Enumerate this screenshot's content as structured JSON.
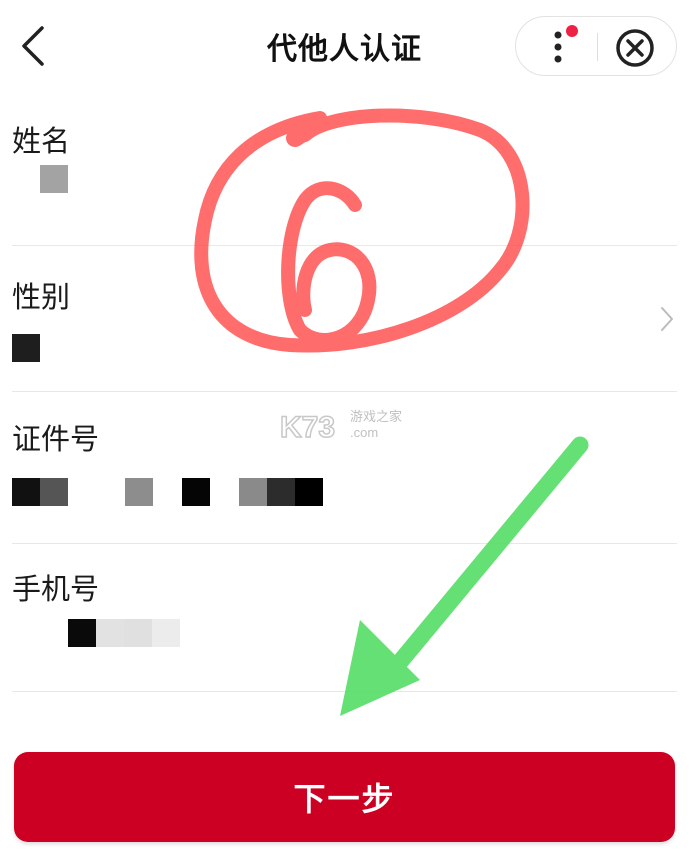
{
  "header": {
    "title": "代他人认证",
    "back_icon": "chevron-left-icon",
    "more_icon": "more-vertical-icon",
    "close_icon": "close-circle-icon",
    "notification_dot_color": "#ee2244"
  },
  "form": {
    "fields": [
      {
        "label": "姓名"
      },
      {
        "label": "性别"
      },
      {
        "label": "证件号"
      },
      {
        "label": "手机号"
      }
    ]
  },
  "watermark": {
    "brand": "K73",
    "cn": "游戏之家",
    "domain": ".com"
  },
  "footer": {
    "next_label": "下一步",
    "button_color": "#cc0022"
  },
  "annotations": {
    "circle_number": "6",
    "circle_color": "#ff4444",
    "arrow_color": "#55dd66"
  }
}
